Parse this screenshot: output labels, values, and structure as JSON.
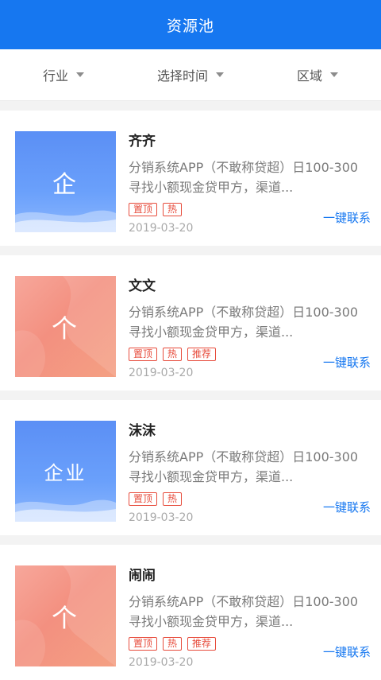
{
  "header": {
    "title": "资源池"
  },
  "filters": [
    {
      "label": "行业"
    },
    {
      "label": "选择时间"
    },
    {
      "label": "区域"
    }
  ],
  "cards": [
    {
      "thumb_text": "企",
      "thumb_style": "blue",
      "name": "齐齐",
      "desc": "分销系统APP（不敢称贷超）日100-300寻找小额现金贷甲方，渠道...",
      "tags": [
        "置顶",
        "热"
      ],
      "date": "2019-03-20",
      "contact": "一键联系"
    },
    {
      "thumb_text": "个",
      "thumb_style": "orange",
      "name": "文文",
      "desc": "分销系统APP（不敢称贷超）日100-300寻找小额现金贷甲方，渠道...",
      "tags": [
        "置顶",
        "热",
        "推荐"
      ],
      "date": "2019-03-20",
      "contact": "一键联系"
    },
    {
      "thumb_text": "企业",
      "thumb_style": "blue",
      "name": "沫沫",
      "desc": "分销系统APP（不敢称贷超）日100-300寻找小额现金贷甲方，渠道...",
      "tags": [
        "置顶",
        "热"
      ],
      "date": "2019-03-20",
      "contact": "一键联系"
    },
    {
      "thumb_text": "个",
      "thumb_style": "orange",
      "name": "闹闹",
      "desc": "分销系统APP（不敢称贷超）日100-300寻找小额现金贷甲方，渠道...",
      "tags": [
        "置顶",
        "热",
        "推荐"
      ],
      "date": "2019-03-20",
      "contact": "一键联系"
    }
  ]
}
